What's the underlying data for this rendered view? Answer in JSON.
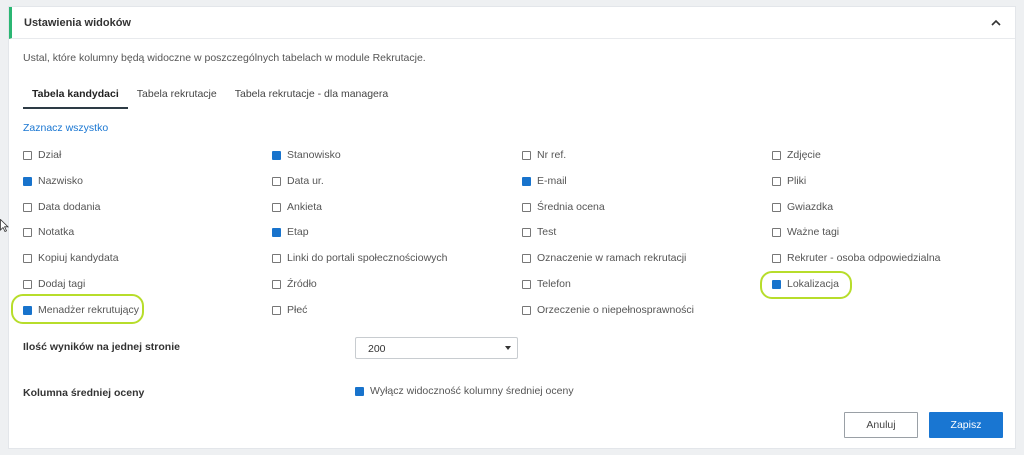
{
  "header": {
    "title": "Ustawienia widoków"
  },
  "description": "Ustal, które kolumny będą widoczne w poszczególnych tabelach w module Rekrutacje.",
  "tabs": [
    {
      "label": "Tabela kandydaci",
      "active": true
    },
    {
      "label": "Tabela rekrutacje",
      "active": false
    },
    {
      "label": "Tabela rekrutacje - dla managera",
      "active": false
    }
  ],
  "select_all": "Zaznacz wszystko",
  "columns": [
    [
      {
        "label": "Dział",
        "checked": false
      },
      {
        "label": "Nazwisko",
        "checked": true
      },
      {
        "label": "Data dodania",
        "checked": false
      },
      {
        "label": "Notatka",
        "checked": false
      },
      {
        "label": "Kopiuj kandydata",
        "checked": false
      },
      {
        "label": "Dodaj tagi",
        "checked": false
      },
      {
        "label": "Menadżer rekrutujący",
        "checked": true
      }
    ],
    [
      {
        "label": "Stanowisko",
        "checked": true
      },
      {
        "label": "Data ur.",
        "checked": false
      },
      {
        "label": "Ankieta",
        "checked": false
      },
      {
        "label": "Etap",
        "checked": true
      },
      {
        "label": "Linki do portali społecznościowych",
        "checked": false
      },
      {
        "label": "Źródło",
        "checked": false
      },
      {
        "label": "Płeć",
        "checked": false
      }
    ],
    [
      {
        "label": "Nr ref.",
        "checked": false
      },
      {
        "label": "E-mail",
        "checked": true
      },
      {
        "label": "Średnia ocena",
        "checked": false
      },
      {
        "label": "Test",
        "checked": false
      },
      {
        "label": "Oznaczenie w ramach rekrutacji",
        "checked": false
      },
      {
        "label": "Telefon",
        "checked": false
      },
      {
        "label": "Orzeczenie o niepełnosprawności",
        "checked": false
      }
    ],
    [
      {
        "label": "Zdjęcie",
        "checked": false
      },
      {
        "label": "Pliki",
        "checked": false
      },
      {
        "label": "Gwiazdka",
        "checked": false
      },
      {
        "label": "Ważne tagi",
        "checked": false
      },
      {
        "label": "Rekruter - osoba odpowiedzialna",
        "checked": false
      },
      {
        "label": "Lokalizacja",
        "checked": true
      }
    ]
  ],
  "results_per_page": {
    "label": "Ilość wyników na jednej stronie",
    "value": "200"
  },
  "avg_rating": {
    "label": "Kolumna średniej oceny",
    "option": "Wyłącz widoczność kolumny średniej oceny",
    "checked": true
  },
  "buttons": {
    "cancel": "Anuluj",
    "save": "Zapisz"
  },
  "colors": {
    "accent": "#1976d2",
    "checked": "#1873cc",
    "header_bar": "#2bb673",
    "highlight": "#b7dd2b"
  },
  "icons": {
    "collapse": "chevron-up-icon",
    "cursor": "mouse-pointer-icon"
  }
}
